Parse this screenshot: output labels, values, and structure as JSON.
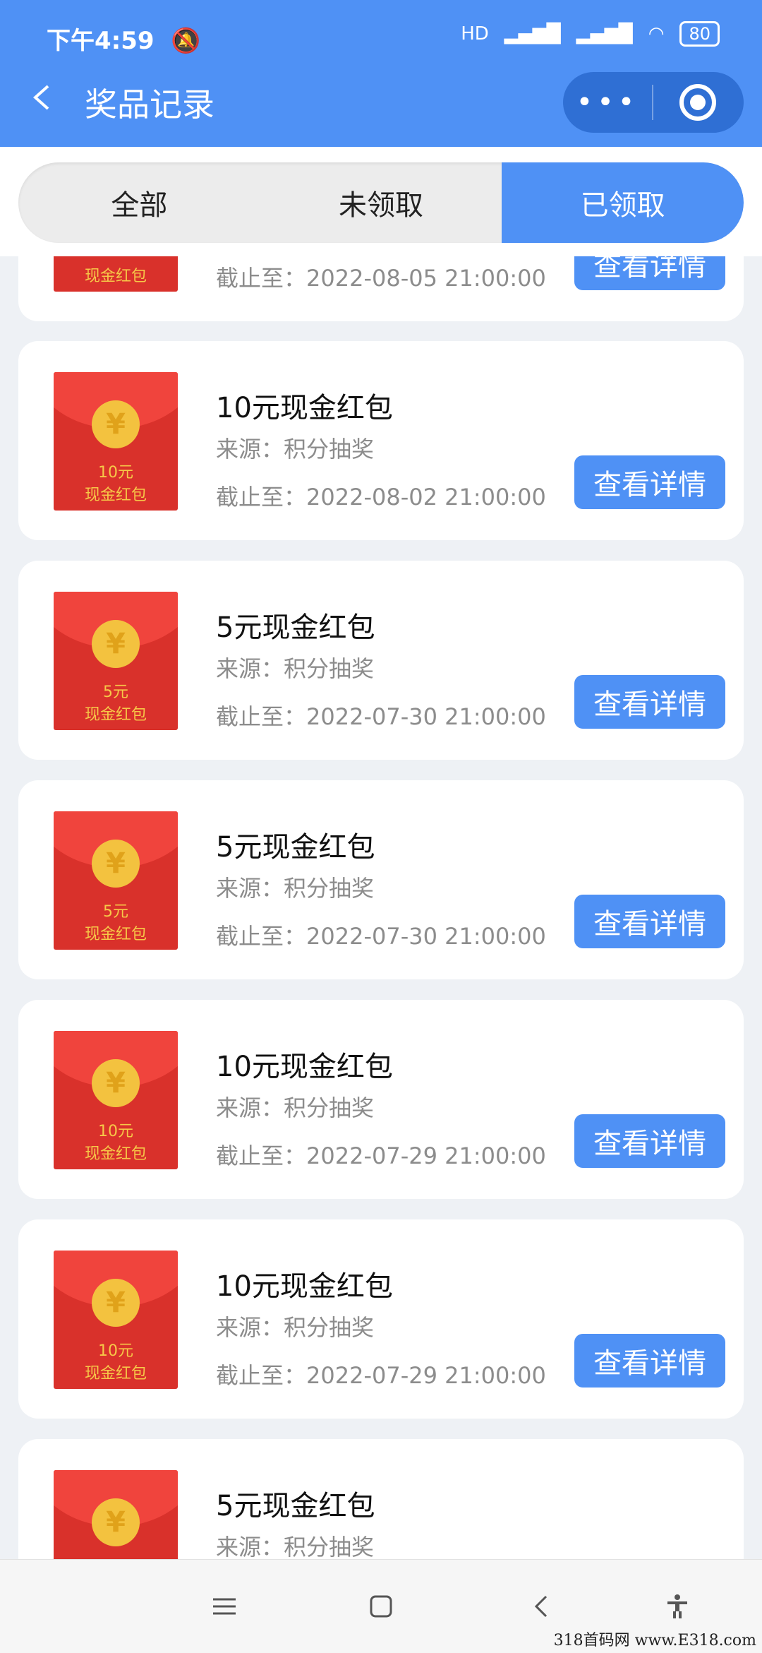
{
  "status_bar": {
    "time": "下午4:59",
    "network": "HD",
    "battery": "80"
  },
  "nav": {
    "title": "奖品记录"
  },
  "tabs": [
    {
      "label": "全部",
      "active": false
    },
    {
      "label": "未领取",
      "active": false
    },
    {
      "label": "已领取",
      "active": true
    }
  ],
  "source_label": "来源：",
  "deadline_label": "截止至：",
  "detail_button": "查看详情",
  "envelope_label": "现金红包",
  "currency_symbol": "¥",
  "items": [
    {
      "title": "",
      "amount": "",
      "source": "",
      "deadline": "2022-08-05 21:00:00"
    },
    {
      "title": "10元现金红包",
      "amount": "10元",
      "source": "积分抽奖",
      "deadline": "2022-08-02 21:00:00"
    },
    {
      "title": "5元现金红包",
      "amount": "5元",
      "source": "积分抽奖",
      "deadline": "2022-07-30 21:00:00"
    },
    {
      "title": "5元现金红包",
      "amount": "5元",
      "source": "积分抽奖",
      "deadline": "2022-07-30 21:00:00"
    },
    {
      "title": "10元现金红包",
      "amount": "10元",
      "source": "积分抽奖",
      "deadline": "2022-07-29 21:00:00"
    },
    {
      "title": "10元现金红包",
      "amount": "10元",
      "source": "积分抽奖",
      "deadline": "2022-07-29 21:00:00"
    },
    {
      "title": "5元现金红包",
      "amount": "5元",
      "source": "积分抽奖",
      "deadline": ""
    }
  ],
  "watermark": "318首码网 www.E318.com",
  "colors": {
    "primary": "#4f91f5",
    "envelope_red": "#d9312b",
    "coin": "#f3c23f"
  }
}
